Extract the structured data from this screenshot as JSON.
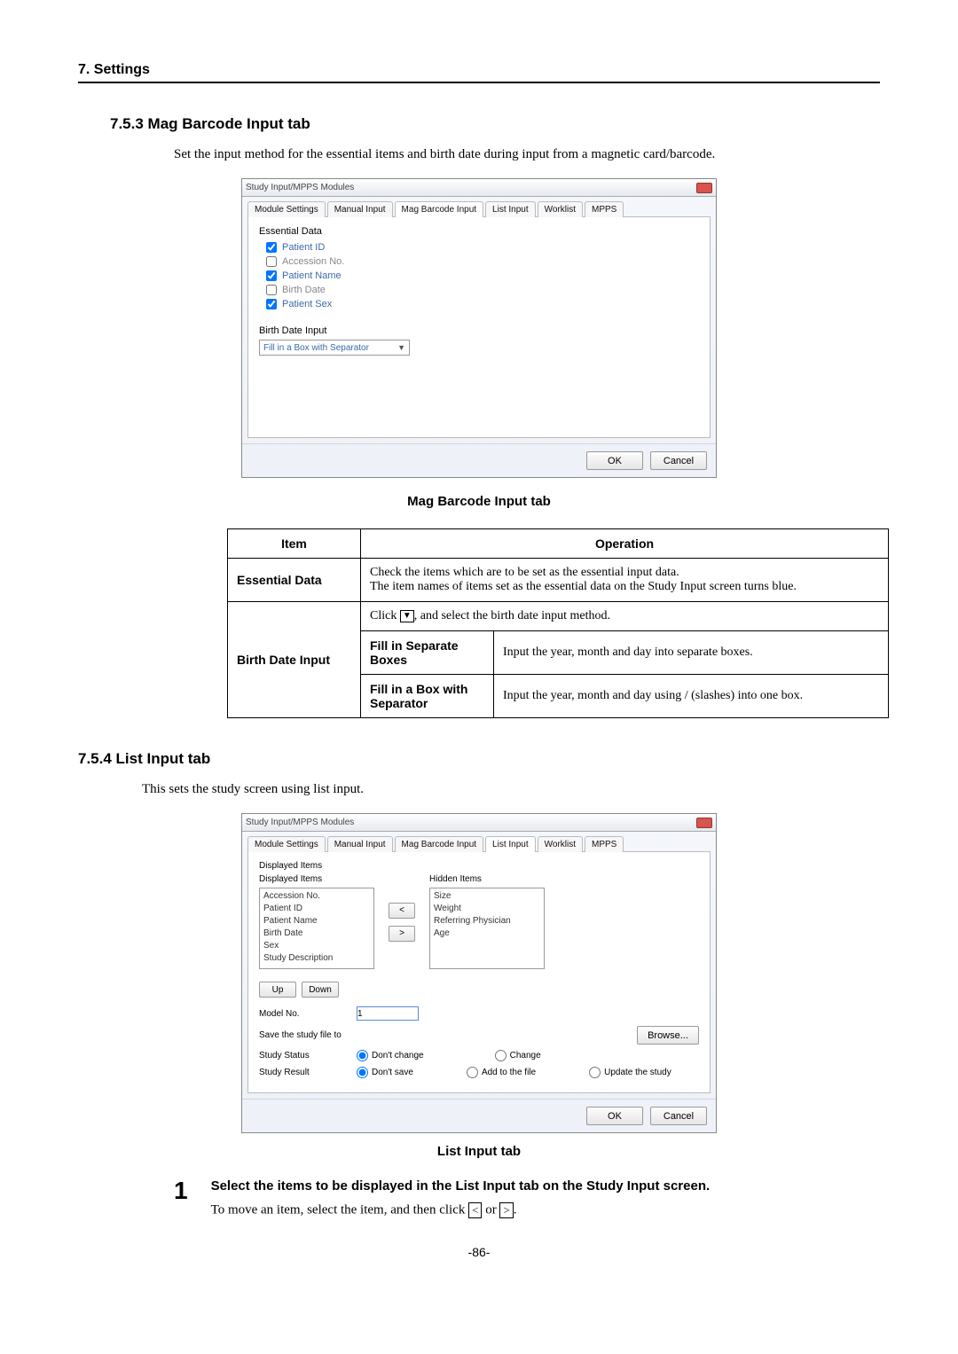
{
  "header": {
    "chapter": "7. Settings"
  },
  "sec753": {
    "heading": "7.5.3 Mag Barcode Input tab",
    "intro": "Set the input method for the essential items and birth date during input from a magnetic card/barcode."
  },
  "shot1": {
    "title": "Study Input/MPPS Modules",
    "tabs": [
      "Module Settings",
      "Manual Input",
      "Mag Barcode Input",
      "List Input",
      "Worklist",
      "MPPS"
    ],
    "activeTab": 2,
    "essential_label": "Essential Data",
    "items": [
      {
        "label": "Patient ID",
        "checked": true
      },
      {
        "label": "Accession No.",
        "checked": false
      },
      {
        "label": "Patient Name",
        "checked": true
      },
      {
        "label": "Birth Date",
        "checked": false
      },
      {
        "label": "Patient Sex",
        "checked": true
      }
    ],
    "bdi_label": "Birth Date Input",
    "bdi_value": "Fill in a Box with Separator",
    "ok": "OK",
    "cancel": "Cancel"
  },
  "caption1": "Mag Barcode Input tab",
  "table1": {
    "h_item": "Item",
    "h_op": "Operation",
    "r1_item": "Essential Data",
    "r1_op": "Check the items which are to be set as the essential input data.\nThe item names of items set as the essential data on the Study Input screen turns blue.",
    "r2_item": "Birth Date Input",
    "r2_op_top_pre": "Click ",
    "r2_op_top_post": ", and select the birth date input method.",
    "r2_a_label": "Fill in Separate Boxes",
    "r2_a_desc": "Input the year, month and day into separate boxes.",
    "r2_b_label": "Fill in a Box with Separator",
    "r2_b_desc": "Input the year, month and day using / (slashes) into one box."
  },
  "sec754": {
    "heading": "7.5.4 List Input tab",
    "intro": "This sets the study screen using list input."
  },
  "shot2": {
    "title": "Study Input/MPPS Modules",
    "tabs": [
      "Module Settings",
      "Manual Input",
      "Mag Barcode Input",
      "List Input",
      "Worklist",
      "MPPS"
    ],
    "activeTab": 3,
    "displayed_section": "Displayed Items",
    "displayed_label": "Displayed Items",
    "hidden_label": "Hidden Items",
    "displayed": [
      "Accession No.",
      "Patient ID",
      "Patient Name",
      "Birth Date",
      "Sex",
      "Study Description"
    ],
    "hidden": [
      "Size",
      "Weight",
      "Referring Physician",
      "Age"
    ],
    "move_left": "<",
    "move_right": ">",
    "up": "Up",
    "down": "Down",
    "model_no_label": "Model No.",
    "model_no_value": "1",
    "save_label": "Save the study file to",
    "browse": "Browse...",
    "status_label": "Study Status",
    "status_opts": [
      "Don't change",
      "Change"
    ],
    "result_label": "Study Result",
    "result_opts": [
      "Don't save",
      "Add to the file",
      "Update the study"
    ],
    "ok": "OK",
    "cancel": "Cancel"
  },
  "caption2": "List Input tab",
  "step1": {
    "num": "1",
    "title": "Select the items to be displayed in the List Input tab on the Study Input screen.",
    "body_pre": "To move an item, select the item, and then click ",
    "body_mid": " or ",
    "body_post": ".",
    "left": "<",
    "right": ">"
  },
  "pagenum": "-86-"
}
